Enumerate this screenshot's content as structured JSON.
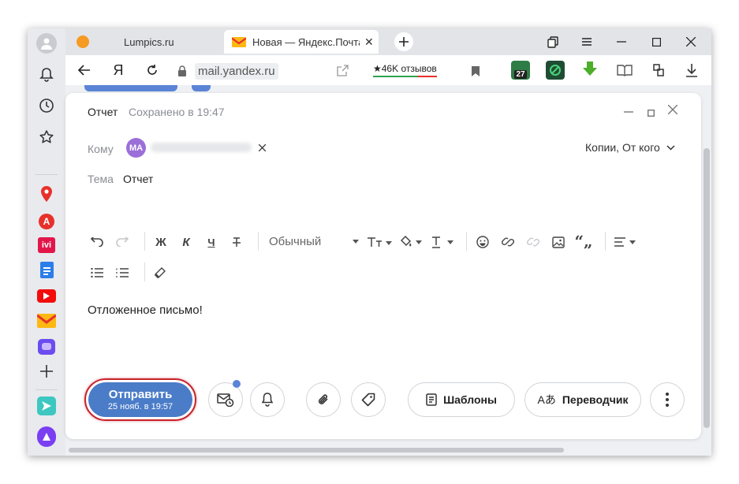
{
  "browser": {
    "tabs": [
      {
        "title": "Lumpics.ru"
      },
      {
        "title": "Новая — Яндекс.Почта"
      }
    ],
    "address": "mail.yandex.ru",
    "yandex_logo": "Я",
    "reviews_badge": "★46K отзывов",
    "ext_badge_count": "27"
  },
  "compose": {
    "header_title": "Отчет",
    "saved_status": "Сохранено в 19:47",
    "to_label": "Кому",
    "recipient_initials": "MA",
    "cc_label": "Копии, От кого",
    "subject_label": "Тема",
    "subject_value": "Отчет",
    "format_select": "Обычный",
    "body_text": "Отложенное письмо!",
    "send_button": {
      "label": "Отправить",
      "sub": "25 нояб. в 19:57"
    },
    "templates_label": "Шаблоны",
    "translator_label": "Переводчик"
  },
  "colors": {
    "send_button": "#4a7cc8",
    "send_outline": "#c8232c",
    "avatar": "#9b6fd8",
    "accent_dot": "#5b84d6"
  },
  "icons": [
    "back-icon",
    "yandex-logo",
    "reload-icon",
    "lock-icon",
    "bookmark-icon",
    "download-icon",
    "undo-icon",
    "redo-icon",
    "bold-icon",
    "italic-icon",
    "underline-icon",
    "strike-icon",
    "emoji-icon",
    "link-icon",
    "image-icon",
    "quote-icon",
    "align-icon",
    "bullet-list-icon",
    "numbered-list-icon",
    "eraser-icon",
    "delay-mail-icon",
    "bell-icon",
    "paperclip-icon",
    "tag-icon",
    "template-icon",
    "translate-icon",
    "more-icon"
  ]
}
